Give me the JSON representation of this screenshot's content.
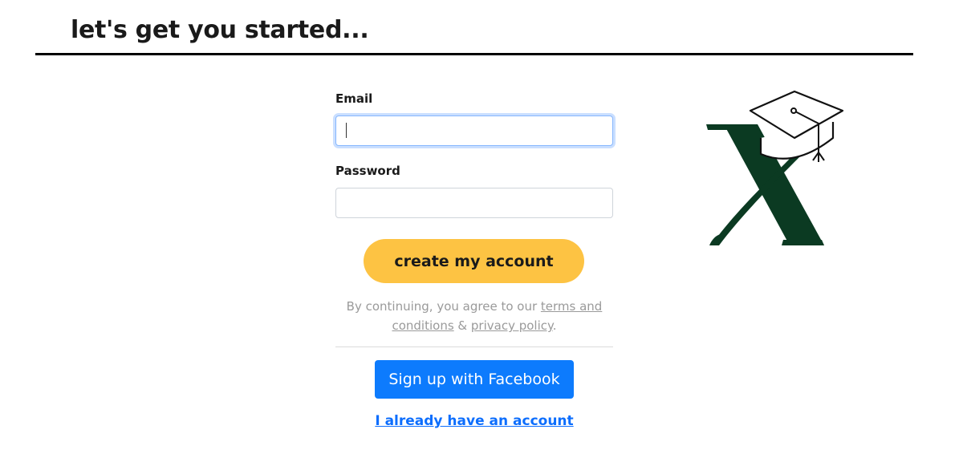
{
  "header": {
    "title": "let's get you started..."
  },
  "form": {
    "email_label": "Email",
    "email_value": "",
    "password_label": "Password",
    "password_value": "",
    "create_button_label": "create my account",
    "consent_prefix": "By continuing, you agree to our ",
    "terms_link": "terms and conditions",
    "consent_and": " & ",
    "privacy_link": "privacy policy",
    "consent_suffix": ".",
    "facebook_button_label": "Sign up with Facebook",
    "login_link_label": "I already have an account"
  },
  "logo": {
    "icon": "graduation-cap-x-logo"
  },
  "colors": {
    "create_button_bg": "#fdc343",
    "facebook_button_bg": "#0d7bfd",
    "link_color": "#0d6efd",
    "logo_green": "#0b3a22"
  }
}
